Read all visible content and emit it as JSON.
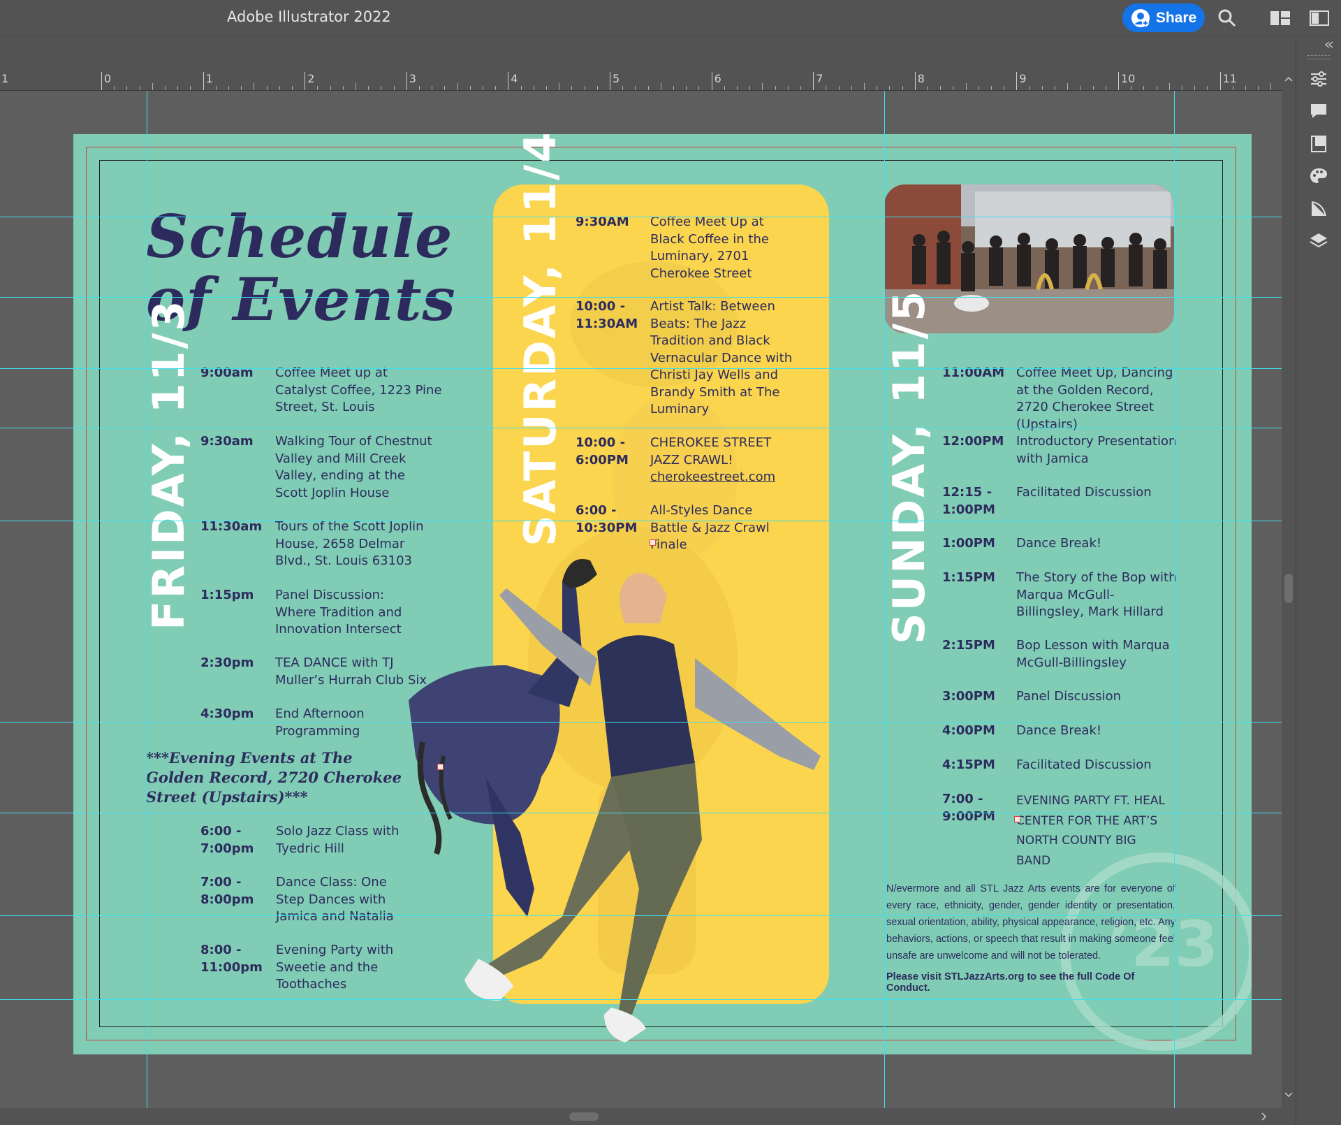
{
  "app": {
    "title": "Adobe Illustrator 2022",
    "share_label": "Share"
  },
  "ruler": {
    "numbers": [
      "1",
      "0",
      "1",
      "2",
      "3",
      "4",
      "5",
      "6",
      "7",
      "8",
      "9",
      "10",
      "11"
    ]
  },
  "document": {
    "title_line1": "Schedule",
    "title_line2": "of Events",
    "friday": {
      "label": "FRIDAY, 11/3",
      "events": [
        {
          "time": "9:00am",
          "desc": "Coffee Meet up at Catalyst Coffee, 1223 Pine Street, St. Louis"
        },
        {
          "time": "9:30am",
          "desc": "Walking Tour of Chestnut Valley and Mill Creek Valley, ending at the Scott Joplin House"
        },
        {
          "time": "11:30am",
          "desc": "Tours of the Scott Joplin House, 2658 Delmar Blvd., St. Louis 63103"
        },
        {
          "time": "1:15pm",
          "desc": "Panel Discussion: Where Tradition and Innovation Intersect"
        },
        {
          "time": "2:30pm",
          "desc": "TEA DANCE with TJ Muller’s Hurrah Club Six"
        },
        {
          "time": "4:30pm",
          "desc": "End Afternoon Programming"
        }
      ],
      "evening_note": "***Evening Events at The Golden Record, 2720 Cherokee Street (Upstairs)***",
      "evening_events": [
        {
          "time": "6:00 - 7:00pm",
          "desc": "Solo Jazz Class with Tyedric Hill"
        },
        {
          "time": "7:00 - 8:00pm",
          "desc": "Dance Class: One Step Dances with Jamica and Natalia"
        },
        {
          "time": "8:00 - 11:00pm",
          "desc": "Evening Party with Sweetie and the Toothaches"
        }
      ]
    },
    "saturday": {
      "label": "SATURDAY, 11/4",
      "events": [
        {
          "time": "9:30AM",
          "desc": "Coffee Meet Up at Black Coffee in the Luminary, 2701 Cherokee Street"
        },
        {
          "time": "10:00 - 11:30AM",
          "desc": "Artist Talk: Between Beats: The Jazz Tradition and Black Vernacular Dance with Christi Jay Wells and Brandy Smith at The Luminary"
        },
        {
          "time": "10:00 - 6:00PM",
          "desc": "CHEROKEE STREET JAZZ CRAWL!",
          "link": "cherokeestreet.com"
        },
        {
          "time": "6:00 - 10:30PM",
          "desc": "All-Styles Dance Battle & Jazz Crawl Finale"
        }
      ]
    },
    "sunday": {
      "label": "SUNDAY, 11/5",
      "events": [
        {
          "time": "11:00AM",
          "desc": "Coffee Meet Up, Dancing at the Golden Record, 2720 Cherokee Street (Upstairs)"
        },
        {
          "time": "12:00PM",
          "desc": "Introductory Presentation with Jamica"
        },
        {
          "time": "12:15 - 1:00PM",
          "desc": "Facilitated Discussion"
        },
        {
          "time": "1:00PM",
          "desc": "Dance Break!"
        },
        {
          "time": "1:15PM",
          "desc": "The Story of the Bop with Marqua McGull-Billingsley, Mark Hillard"
        },
        {
          "time": "2:15PM",
          "desc": "Bop Lesson with Marqua McGull-Billingsley"
        },
        {
          "time": "3:00PM",
          "desc": "Panel Discussion"
        },
        {
          "time": "4:00PM",
          "desc": "Dance Break!"
        },
        {
          "time": "4:15PM",
          "desc": "Facilitated Discussion"
        },
        {
          "time": "7:00 - 9:00PM",
          "desc": "EVENING PARTY FT. HEAL CENTER FOR THE ART’S NORTH COUNTY BIG BAND"
        }
      ]
    },
    "code_of_conduct": "N/evermore and all STL Jazz Arts events are for everyone of every race, ethnicity, gender, gender identity or presentation, sexual orientation, ability, physical appearance, religion, etc. Any behaviors, actions, or speech that result in making someone feel unsafe are unwelcome and will not be tolerated.",
    "code_of_conduct_link": "Please visit STLJazzArts.org to see the full Code Of Conduct.",
    "watermark": "’23"
  },
  "colors": {
    "artboard": "#80ccb4",
    "navy": "#2d2b5e",
    "yellow": "#fbd54d",
    "guide": "#3ee0f0",
    "share": "#1473e6"
  }
}
